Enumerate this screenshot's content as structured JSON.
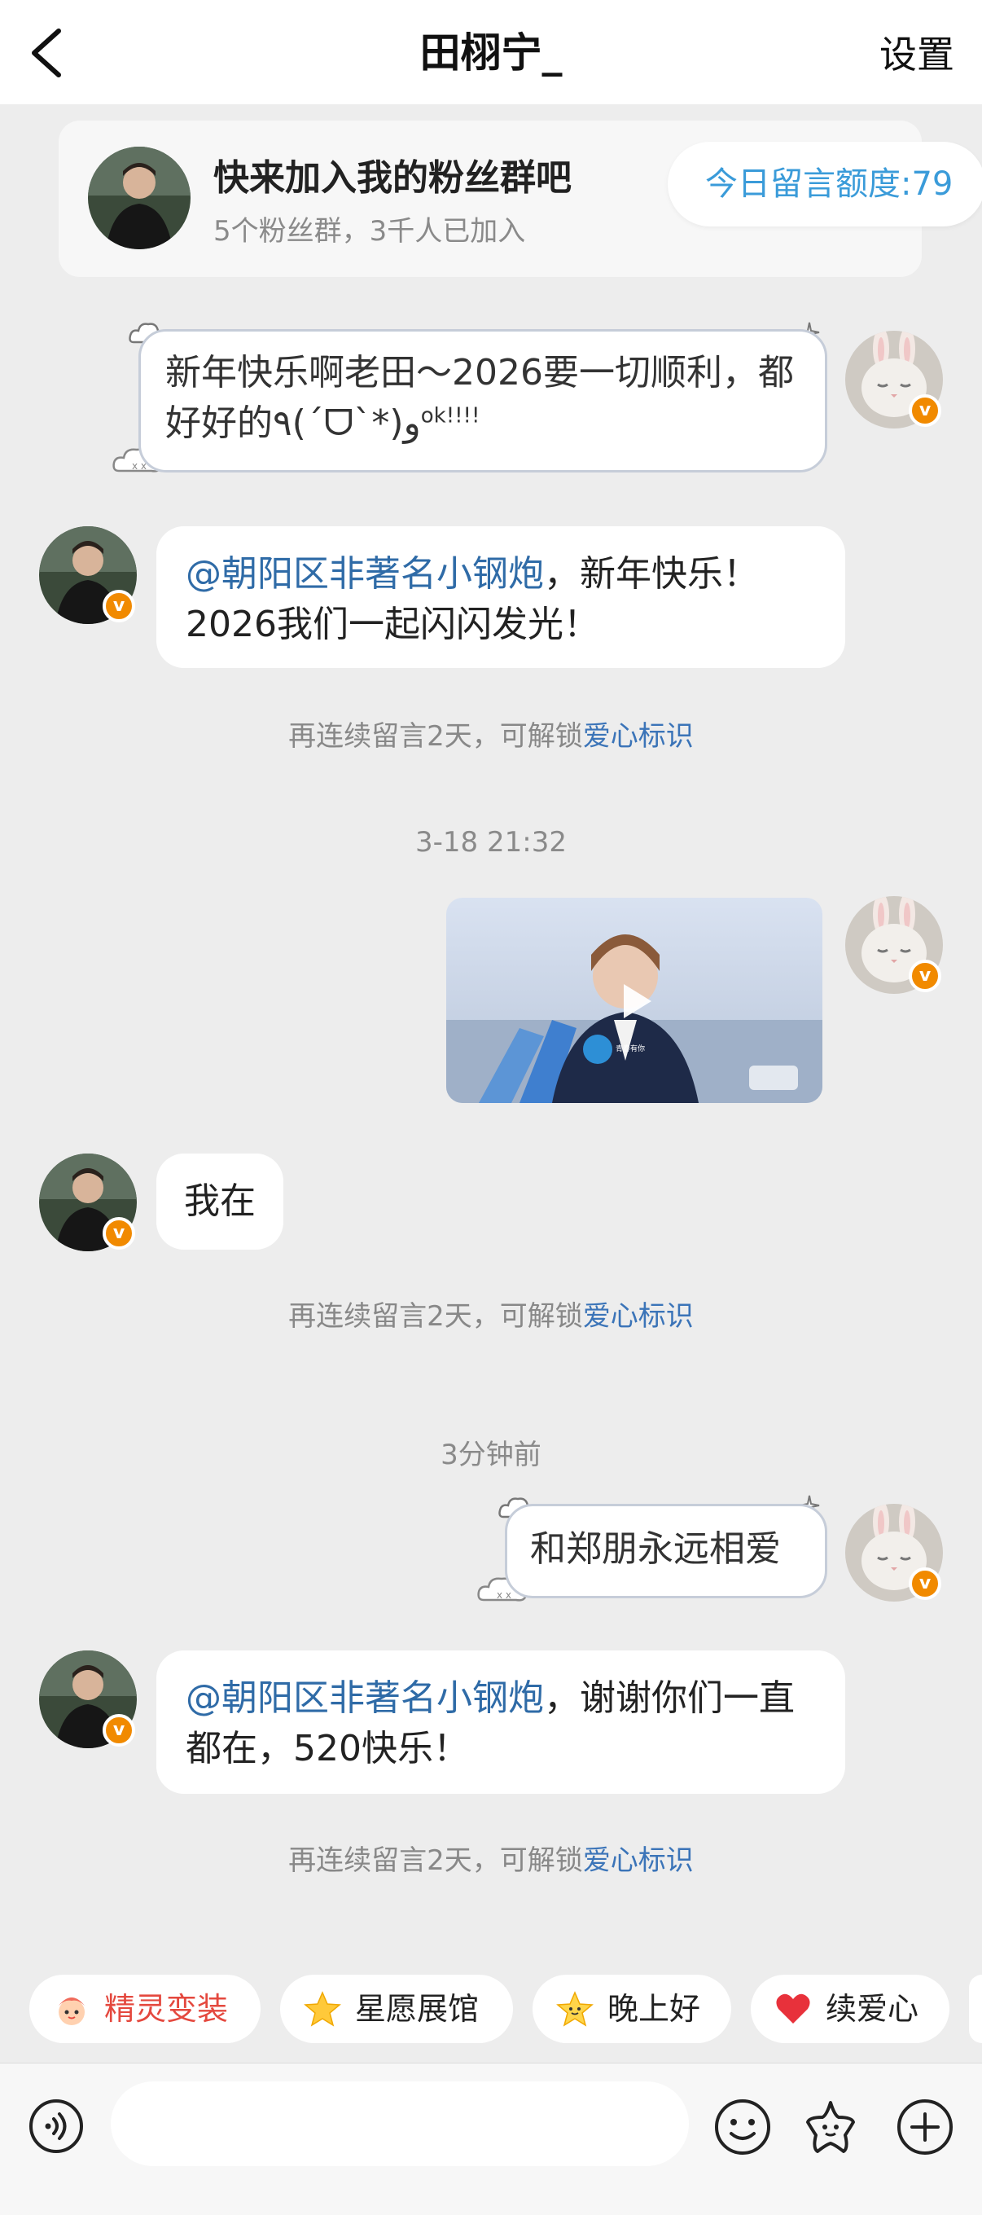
{
  "header": {
    "title": "田栩宁_",
    "settings_label": "设置",
    "back_icon": "chevron-left-icon"
  },
  "fan_group": {
    "title": "快来加入我的粉丝群吧",
    "subtitle": "5个粉丝群，3千人已加入"
  },
  "quota": {
    "label": "今日留言额度:79"
  },
  "messages": [
    {
      "side": "right",
      "style": "outlined",
      "text": "新年快乐啊老田～2026要一切顺利，都好好的٩(ˊᗜˋ*)و",
      "suffix": "ok!!!!"
    },
    {
      "side": "left",
      "mention": "@朝阳区非著名小钢炮",
      "text": "，新年快乐！2026我们一起闪闪发光！"
    },
    {
      "side": "left",
      "text": "我在"
    },
    {
      "side": "right",
      "style": "outlined",
      "text": "和郑朋永远相爱"
    },
    {
      "side": "left",
      "mention": "@朝阳区非著名小钢炮",
      "text": "，谢谢你们一直都在，520快乐！"
    }
  ],
  "hints": [
    {
      "text": "再连续留言2天，可解锁",
      "highlight": "爱心标识"
    },
    {
      "text": "再连续留言2天，可解锁",
      "highlight": "爱心标识"
    },
    {
      "text": "再连续留言2天，可解锁",
      "highlight": "爱心标识"
    }
  ],
  "timestamps": [
    "3-18 21:32",
    "3分钟前"
  ],
  "video": {
    "logo_text": "青春有你"
  },
  "chips": [
    {
      "label": "精灵变装",
      "icon": "sprite-icon",
      "color": "#e4483e"
    },
    {
      "label": "星愿展馆",
      "icon": "star-icon",
      "color": "#333333"
    },
    {
      "label": "晚上好",
      "icon": "smiling-star-icon",
      "color": "#333333"
    },
    {
      "label": "续爱心",
      "icon": "heart-icon",
      "color": "#333333"
    }
  ],
  "input": {
    "placeholder": ""
  },
  "colors": {
    "accent_blue": "#3a9bd9",
    "mention_blue": "#2f6ba7",
    "verified_orange": "#f18a00",
    "background": "#ededed"
  }
}
